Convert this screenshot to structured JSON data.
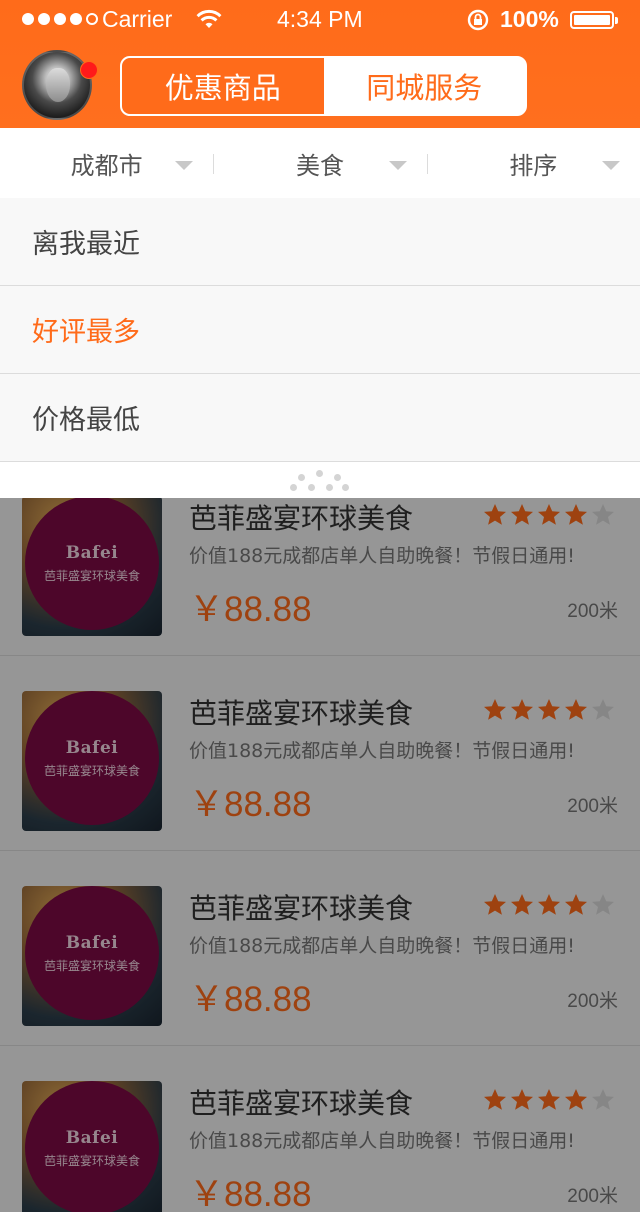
{
  "status_bar": {
    "carrier": "Carrier",
    "time": "4:34 PM",
    "battery": "100%"
  },
  "header": {
    "tabs": [
      {
        "label": "优惠商品",
        "active": true
      },
      {
        "label": "同城服务",
        "active": false
      }
    ]
  },
  "filters": [
    {
      "label": "成都市"
    },
    {
      "label": "美食"
    },
    {
      "label": "排序"
    }
  ],
  "sort_menu": {
    "options": [
      {
        "label": "离我最近",
        "selected": false
      },
      {
        "label": "好评最多",
        "selected": true
      },
      {
        "label": "价格最低",
        "selected": false
      }
    ]
  },
  "listings": [
    {
      "logo_en": "Bafei",
      "logo_cn": "芭菲盛宴环球美食",
      "title": "芭菲盛宴环球美食",
      "subtitle": "价值188元成都店单人自助晚餐！节假日通用!",
      "price": "￥88.88",
      "distance": "200米",
      "rating": 4,
      "rating_max": 5
    },
    {
      "logo_en": "Bafei",
      "logo_cn": "芭菲盛宴环球美食",
      "title": "芭菲盛宴环球美食",
      "subtitle": "价值188元成都店单人自助晚餐！节假日通用!",
      "price": "￥88.88",
      "distance": "200米",
      "rating": 4,
      "rating_max": 5
    },
    {
      "logo_en": "Bafei",
      "logo_cn": "芭菲盛宴环球美食",
      "title": "芭菲盛宴环球美食",
      "subtitle": "价值188元成都店单人自助晚餐！节假日通用!",
      "price": "￥88.88",
      "distance": "200米",
      "rating": 4,
      "rating_max": 5
    },
    {
      "logo_en": "Bafei",
      "logo_cn": "芭菲盛宴环球美食",
      "title": "芭菲盛宴环球美食",
      "subtitle": "价值188元成都店单人自助晚餐！节假日通用!",
      "price": "￥88.88",
      "distance": "200米",
      "rating": 4,
      "rating_max": 5
    }
  ],
  "colors": {
    "accent": "#ff6b1a",
    "star_filled": "#ff6b1a",
    "star_empty": "#d9d9d9",
    "logo_disc": "#7c0a45"
  }
}
